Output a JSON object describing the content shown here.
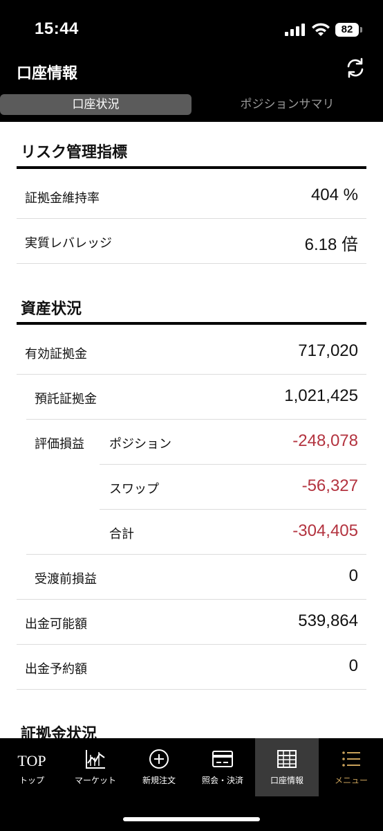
{
  "status": {
    "time": "15:44",
    "battery": "82",
    "icons": [
      "signal-icon",
      "wifi-icon",
      "battery-icon"
    ]
  },
  "header": {
    "title": "口座情報",
    "refresh_icon": "refresh-icon"
  },
  "tabs": [
    {
      "label": "口座状況",
      "active": true
    },
    {
      "label": "ポジションサマリ",
      "active": false
    }
  ],
  "risk": {
    "title": "リスク管理指標",
    "rows": [
      {
        "label": "証拠金維持率",
        "value": "404 %"
      },
      {
        "label": "実質レバレッジ",
        "value": "6.18 倍"
      }
    ]
  },
  "assets": {
    "title": "資産状況",
    "effective_margin": {
      "label": "有効証拠金",
      "value": "717,020"
    },
    "deposit_margin": {
      "label": "預託証拠金",
      "value": "1,021,425"
    },
    "valuation": {
      "label": "評価損益",
      "rows": [
        {
          "label": "ポジション",
          "value": "-248,078"
        },
        {
          "label": "スワップ",
          "value": "-56,327"
        },
        {
          "label": "合計",
          "value": "-304,405"
        }
      ]
    },
    "pre_settlement": {
      "label": "受渡前損益",
      "value": "0"
    },
    "withdrawable": {
      "label": "出金可能額",
      "value": "539,864"
    },
    "withdraw_reserved": {
      "label": "出金予約額",
      "value": "0"
    }
  },
  "margin_status": {
    "title": "証拠金状況"
  },
  "nav": [
    {
      "label": "トップ",
      "icon": "top-text-icon",
      "top_text": "TOP"
    },
    {
      "label": "マーケット",
      "icon": "chart-icon"
    },
    {
      "label": "新規注文",
      "icon": "plus-circle-icon"
    },
    {
      "label": "照会・決済",
      "icon": "card-icon"
    },
    {
      "label": "口座情報",
      "icon": "grid-icon",
      "active": true
    },
    {
      "label": "メニュー",
      "icon": "menu-icon",
      "accent": "#c9a15a"
    }
  ],
  "colors": {
    "negative": "#b3333f",
    "accent": "#c9a15a",
    "active_tab": "#5b5b5b"
  }
}
